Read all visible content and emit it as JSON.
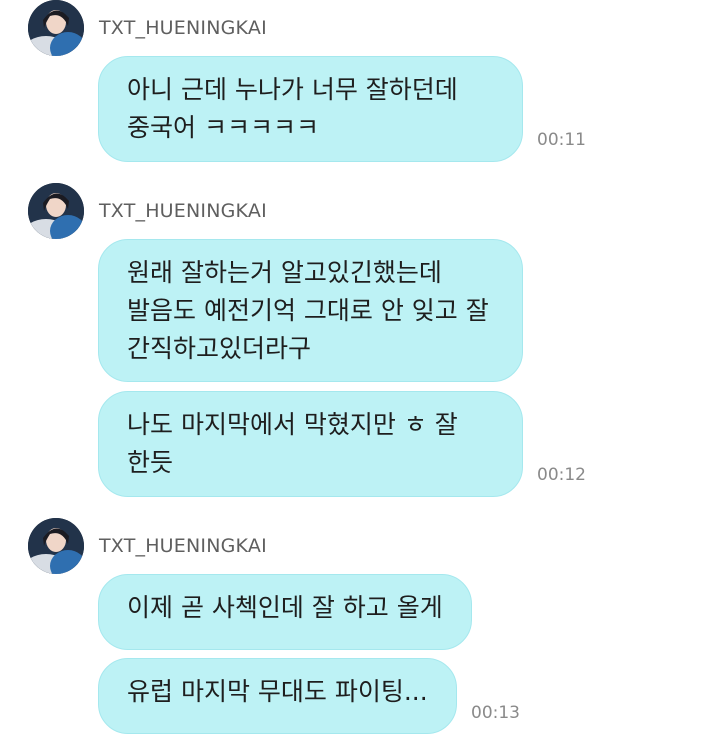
{
  "messages": [
    {
      "sender": "TXT_HUENINGKAI",
      "bubbles": [
        {
          "text": "아니 근데 누나가 너무 잘하던데\n중국어 ㅋㅋㅋㅋㅋ",
          "time": "00:11"
        }
      ]
    },
    {
      "sender": "TXT_HUENINGKAI",
      "bubbles": [
        {
          "text": "원래 잘하는거 알고있긴했는데\n발음도 예전기억 그대로 안 잊고 잘\n간직하고있더라구",
          "time": ""
        },
        {
          "text": "나도 마지막에서 막혔지만 ㅎ 잘\n한듯",
          "time": "00:12"
        }
      ]
    },
    {
      "sender": "TXT_HUENINGKAI",
      "bubbles": [
        {
          "text": "이제 곧 사첵인데 잘 하고 올게",
          "time": ""
        },
        {
          "text": "유럽 마지막 무대도 파이팅...",
          "time": "00:13"
        }
      ]
    }
  ],
  "colors": {
    "bubble": "#bdf2f5",
    "bubble_border": "#a5e8ee",
    "sender_text": "#5f5f5f",
    "time_text": "#8a8a8a"
  },
  "icons": {
    "avatar": "profile-photo"
  }
}
